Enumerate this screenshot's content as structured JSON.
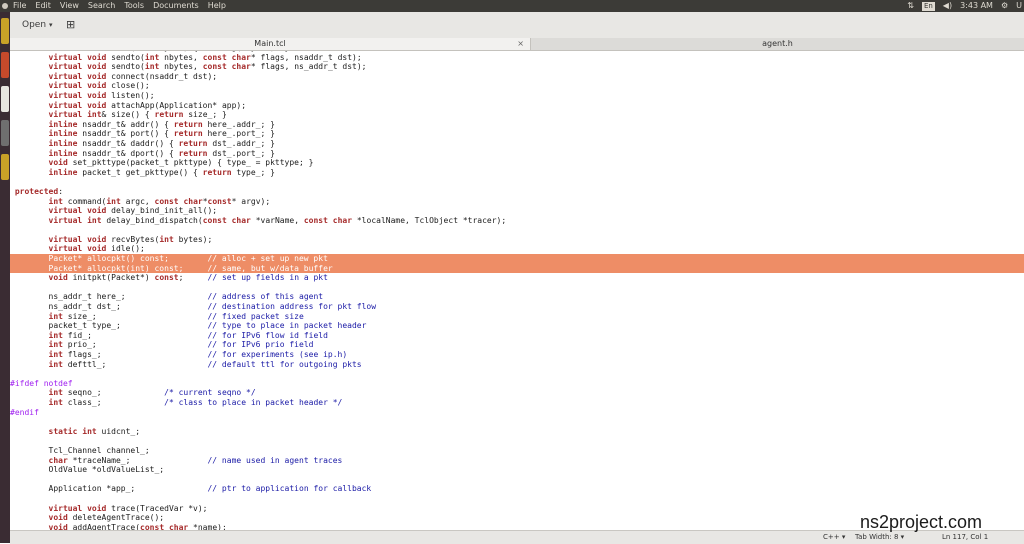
{
  "menubar": {
    "items": [
      "File",
      "Edit",
      "View",
      "Search",
      "Tools",
      "Documents",
      "Help"
    ],
    "keyboard": "En",
    "time": "3:43 AM",
    "user_initial": "U"
  },
  "toolbar": {
    "open_label": "Open",
    "newdoc_icon": "new-document-icon"
  },
  "tabs": [
    {
      "label": "Main.tcl",
      "close": "×"
    },
    {
      "label": "agent.h"
    }
  ],
  "colors": {
    "keyword": "#a52a2a",
    "comment": "#1a1aa6",
    "preprocessor": "#a020f0",
    "highlight": "#ee8d66",
    "accent_protected": "#a52a2a"
  },
  "code": {
    "lines": [
      "        virtual void send(int nbytes) { sendmsg(nbytes); }",
      "        virtual void sendto(int nbytes, const char* flags, nsaddr_t dst);",
      "        virtual void sendto(int nbytes, const char* flags, ns_addr_t dst);",
      "        virtual void connect(nsaddr_t dst);",
      "        virtual void close();",
      "        virtual void listen();",
      "        virtual void attachApp(Application* app);",
      "        virtual int& size() { return size_; }",
      "        inline nsaddr_t& addr() { return here_.addr_; }",
      "        inline nsaddr_t& port() { return here_.port_; }",
      "        inline nsaddr_t& daddr() { return dst_.addr_; }",
      "        inline nsaddr_t& dport() { return dst_.port_; }",
      "        void set_pkttype(packet_t pkttype) { type_ = pkttype; }",
      "        inline packet_t get_pkttype() { return type_; }",
      "",
      " protected:",
      "        int command(int argc, const char*const* argv);",
      "        virtual void delay_bind_init_all();",
      "        virtual int delay_bind_dispatch(const char *varName, const char *localName, TclObject *tracer);",
      "",
      "        virtual void recvBytes(int bytes);",
      "        virtual void idle();",
      "        Packet* allocpkt() const;        // alloc + set up new pkt",
      "        Packet* allocpkt(int) const;     // same, but w/data buffer",
      "        void initpkt(Packet*) const;     // set up fields in a pkt",
      "",
      "        ns_addr_t here_;                 // address of this agent",
      "        ns_addr_t dst_;                  // destination address for pkt flow",
      "        int size_;                       // fixed packet size",
      "        packet_t type_;                  // type to place in packet header",
      "        int fid_;                        // for IPv6 flow id field",
      "        int prio_;                       // for IPv6 prio field",
      "        int flags_;                      // for experiments (see ip.h)",
      "        int defttl_;                     // default ttl for outgoing pkts",
      "",
      "#ifdef notdef",
      "        int seqno_;             /* current seqno */",
      "        int class_;             /* class to place in packet header */",
      "#endif",
      "",
      "        static int uidcnt_;",
      "",
      "        Tcl_Channel channel_;",
      "        char *traceName_;                // name used in agent traces",
      "        OldValue *oldValueList_;",
      "",
      "        Application *app_;               // ptr to application for callback",
      "",
      "        virtual void trace(TracedVar *v);",
      "        void deleteAgentTrace();",
      "        void addAgentTrace(const char *name);"
    ],
    "highlighted_lines": [
      22,
      23
    ]
  },
  "statusbar": {
    "language": "C++",
    "tab_width": "Tab Width: 8",
    "position": "Ln 117, Col 1"
  },
  "watermark": "ns2project.com"
}
